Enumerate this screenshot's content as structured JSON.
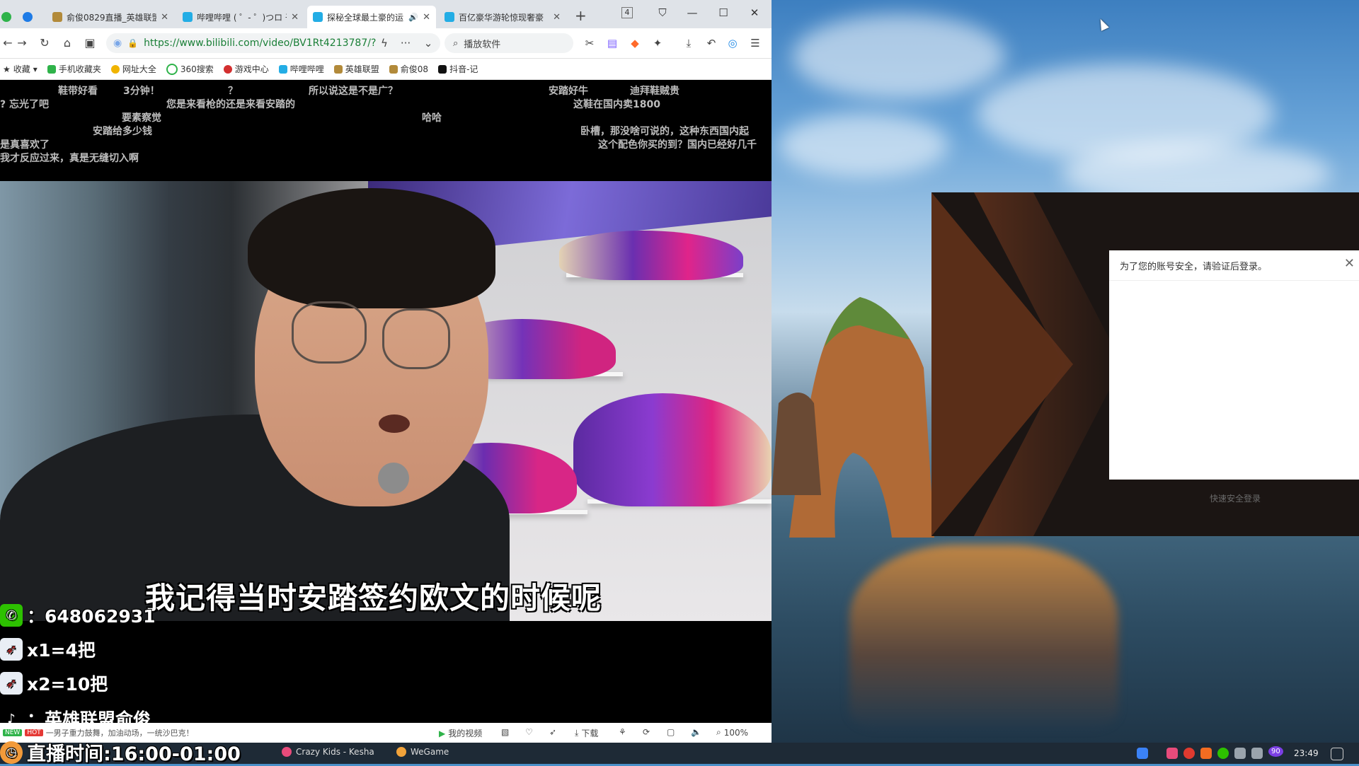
{
  "browser": {
    "tabs": [
      {
        "title": "俞俊0829直播_英雄联盟",
        "active": false
      },
      {
        "title": "哔哩哔哩 ( ゜- ゜)つロ 干",
        "active": false
      },
      {
        "title": "探秘全球最土豪的运",
        "active": true
      },
      {
        "title": "百亿豪华游轮惊现奢豪",
        "active": false
      }
    ],
    "tab_count_badge": "4",
    "url": "https://www.bilibili.com/video/BV1Rt4213787/?",
    "search_placeholder": "播放软件",
    "bookmarks": [
      "收藏",
      "手机收藏夹",
      "网址大全",
      "360搜索",
      "游戏中心",
      "哔哩哔哩",
      "英雄联盟",
      "俞俊08",
      "抖音-记"
    ]
  },
  "danmaku": [
    "鞋带好看",
    "3分钟！",
    "？",
    "所以说这是不是广？",
    "安踏好牛",
    "迪拜鞋贼贵",
    "? 忘光了吧",
    "您是来看枪的还是来看安踏的",
    "这鞋在国内卖1800",
    "要素察觉",
    "哈哈",
    "安踏给多少钱",
    "卧槽，那没啥可说的，这种东西国内起",
    "是真喜欢了",
    "这个配色你买的到？国内已经好几千",
    "我才反应过来，真是无缝切入啊"
  ],
  "video": {
    "subtitle": "我记得当时安踏签约欧文的时候呢"
  },
  "overlay": {
    "wechat": "：648062931",
    "x1": "x1=4把",
    "x2": "x2=10把",
    "douyin": "：英雄联盟俞俊",
    "live_time": "直播时间:16:00-01:00"
  },
  "controlbar": {
    "news": "一男子重力鼓舞，加油动场，一统沙巴克！",
    "my_video": "我的视频",
    "download": "下载",
    "zoom": "100%"
  },
  "login": {
    "notice": "为了您的账号安全，请验证后登录。",
    "quick_login": "快速安全登录"
  },
  "taskbar": {
    "apps": [
      "Crazy Kids - Kesha",
      "WeGame"
    ],
    "badge_count": "90",
    "time": "23:49"
  }
}
